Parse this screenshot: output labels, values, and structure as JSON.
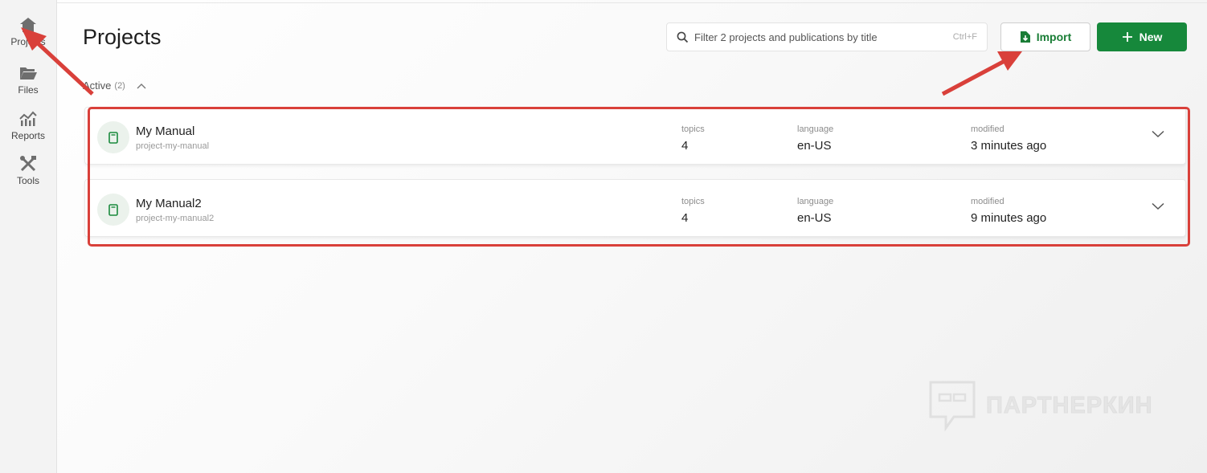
{
  "sidebar": {
    "items": [
      {
        "label": "Projects",
        "icon": "home-icon"
      },
      {
        "label": "Files",
        "icon": "folder-icon"
      },
      {
        "label": "Reports",
        "icon": "chart-icon"
      },
      {
        "label": "Tools",
        "icon": "tools-icon"
      }
    ]
  },
  "header": {
    "title": "Projects",
    "search_placeholder": "Filter 2 projects and publications by title",
    "search_shortcut": "Ctrl+F",
    "import_label": "Import",
    "new_label": "New"
  },
  "section": {
    "label": "Active",
    "count": "(2)"
  },
  "projects": [
    {
      "name": "My Manual",
      "slug": "project-my-manual",
      "topics_label": "topics",
      "topics": "4",
      "language_label": "language",
      "language": "en-US",
      "modified_label": "modified",
      "modified": "3 minutes ago"
    },
    {
      "name": "My Manual2",
      "slug": "project-my-manual2",
      "topics_label": "topics",
      "topics": "4",
      "language_label": "language",
      "language": "en-US",
      "modified_label": "modified",
      "modified": "9 minutes ago"
    }
  ],
  "watermark": {
    "text": "ПАРТНЕРКИН"
  },
  "colors": {
    "accent": "#16883b",
    "annotation": "#d9403a"
  }
}
